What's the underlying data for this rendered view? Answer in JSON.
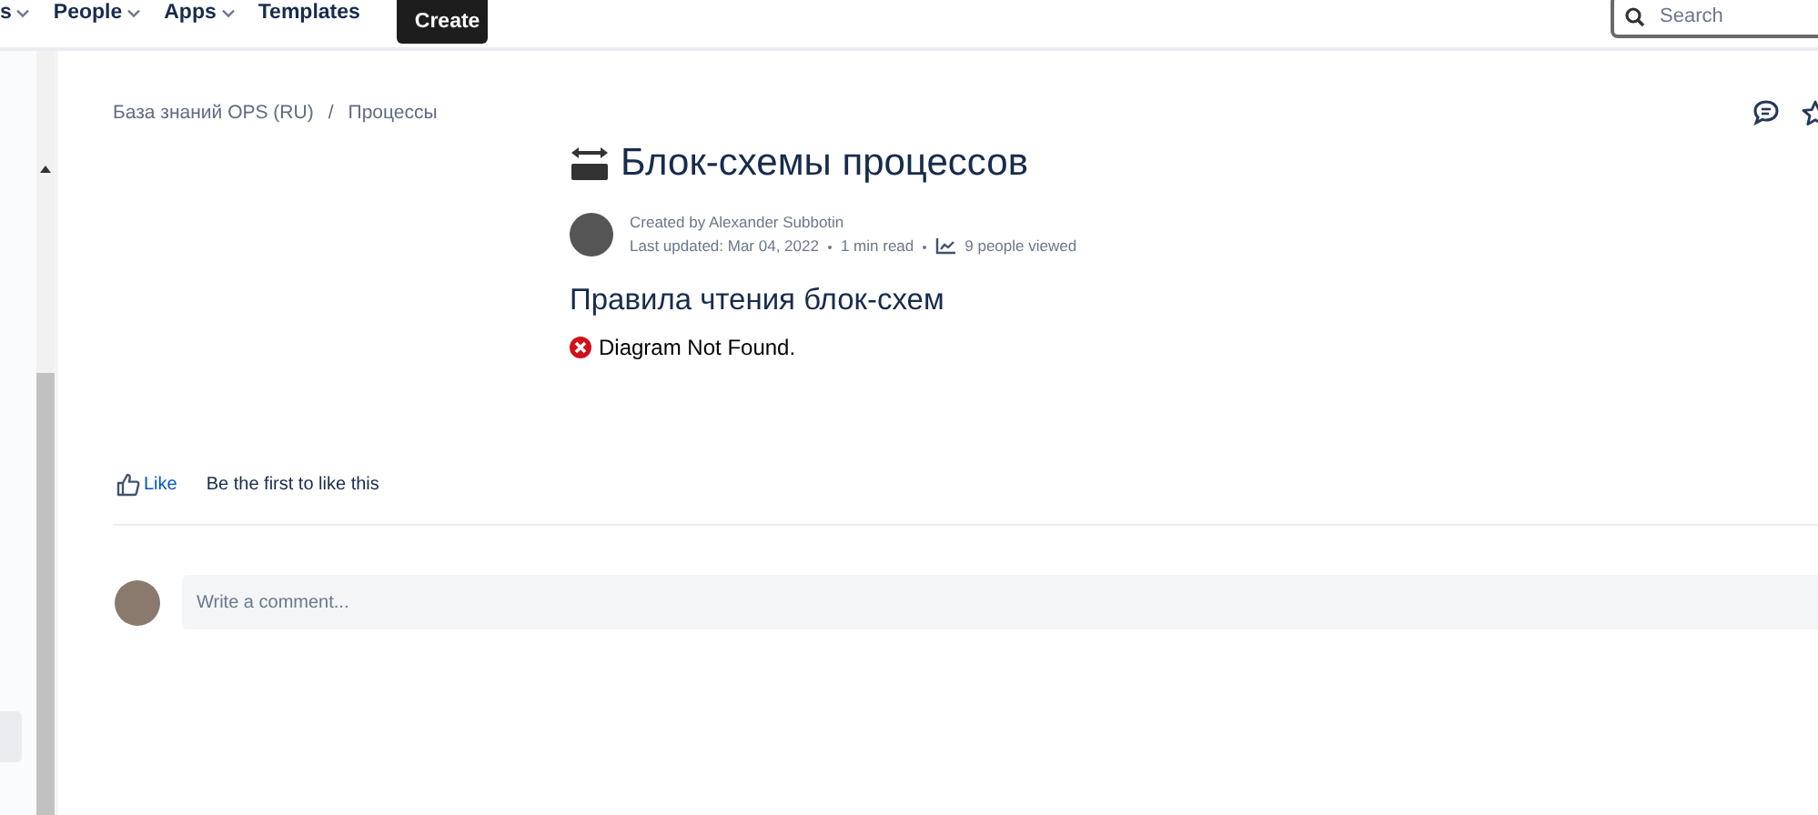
{
  "top_nav": {
    "items": [
      {
        "label": "s",
        "dropdown": true
      },
      {
        "label": "People",
        "dropdown": true
      },
      {
        "label": "Apps",
        "dropdown": true
      },
      {
        "label": "Templates",
        "dropdown": false
      }
    ],
    "create_button": "Create",
    "search": {
      "placeholder": "Search"
    }
  },
  "breadcrumbs": [
    "База знаний OPS (RU)",
    "Процессы"
  ],
  "breadcrumb_separator": "/",
  "page": {
    "title": "Блок-схемы процессов",
    "created_by": "Created by Alexander Subbotin",
    "last_updated": "Last updated: Mar 04, 2022",
    "read_time": "1 min read",
    "views": "9 people viewed",
    "heading": "Правила чтения блок-схем",
    "error": "Diagram Not Found."
  },
  "likes": {
    "like_label": "Like",
    "summary": "Be the first to like this"
  },
  "comment": {
    "placeholder": "Write a comment..."
  }
}
